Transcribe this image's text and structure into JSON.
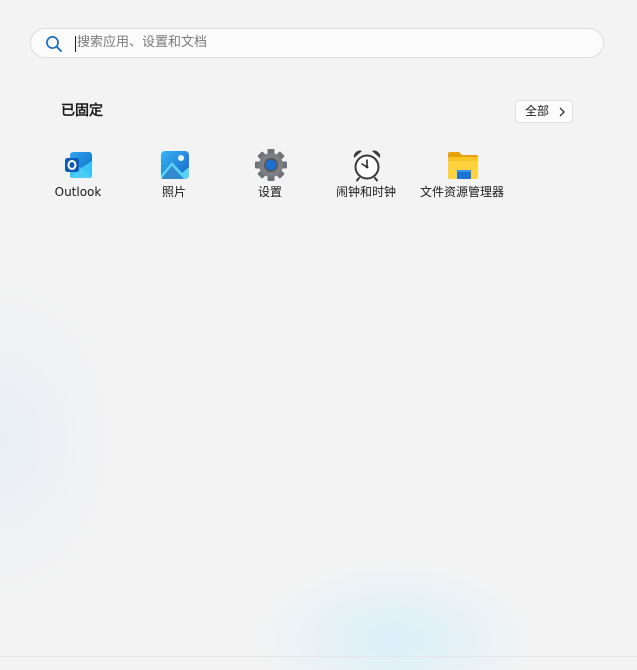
{
  "search": {
    "placeholder": "搜索应用、设置和文档",
    "icon": "search-icon"
  },
  "pinned": {
    "title": "已固定",
    "all_button": {
      "label": "全部",
      "icon": "chevron-right-icon"
    },
    "apps": [
      {
        "label": "Outlook",
        "icon": "outlook-icon"
      },
      {
        "label": "照片",
        "icon": "photos-icon"
      },
      {
        "label": "设置",
        "icon": "settings-gear-icon"
      },
      {
        "label": "闹钟和时钟",
        "icon": "alarm-clock-icon"
      },
      {
        "label": "文件资源管理器",
        "icon": "file-explorer-folder-icon"
      }
    ]
  },
  "colors": {
    "background": "#f3f3f3",
    "accent": "#0067c0"
  }
}
